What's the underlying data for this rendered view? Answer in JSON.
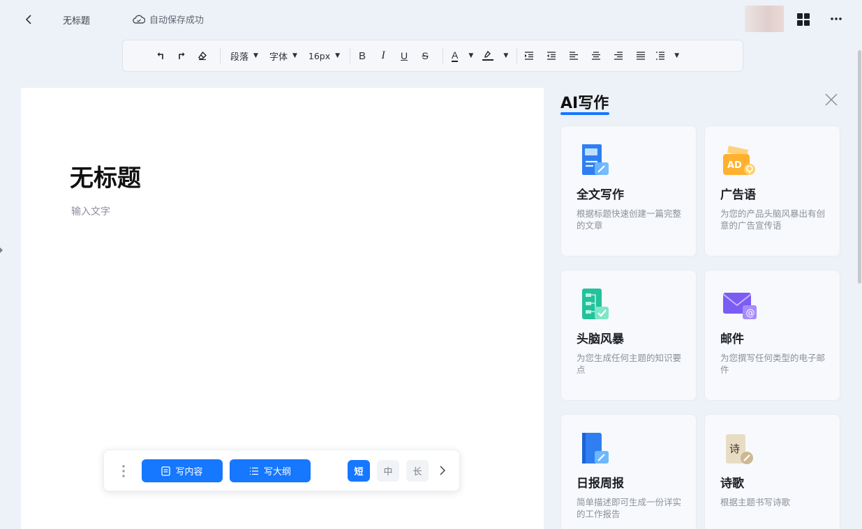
{
  "header": {
    "doc_name": "无标题",
    "save_status": "自动保存成功"
  },
  "toolbar": {
    "paragraph": "段落",
    "font": "字体",
    "size": "16px",
    "bold": "B",
    "italic": "I",
    "underline": "U",
    "strike": "S",
    "font_color": "A"
  },
  "editor": {
    "title": "无标题",
    "placeholder": "输入文字"
  },
  "ai_bar": {
    "write_content": "写内容",
    "write_outline": "写大纲",
    "length_short": "短",
    "length_medium": "中",
    "length_long": "长",
    "selected_length": "短"
  },
  "panel": {
    "title": "AI写作",
    "cards": [
      {
        "title": "全文写作",
        "desc": "根据标题快速创建一篇完整的文章",
        "icon": "document-edit-icon"
      },
      {
        "title": "广告语",
        "desc": "为您的产品头脑风暴出有创意的广告宣传语",
        "icon": "ad-icon"
      },
      {
        "title": "头脑风暴",
        "desc": "为您生成任何主题的知识要点",
        "icon": "mindmap-icon"
      },
      {
        "title": "邮件",
        "desc": "为您撰写任何类型的电子邮件",
        "icon": "mail-icon"
      },
      {
        "title": "日报周报",
        "desc": "简单描述即可生成一份详实的工作报告",
        "icon": "report-book-icon"
      },
      {
        "title": "诗歌",
        "desc": "根据主题书写诗歌",
        "icon": "poem-scroll-icon"
      }
    ]
  },
  "colors": {
    "accent": "#1677ff",
    "background": "#edf1f8"
  }
}
